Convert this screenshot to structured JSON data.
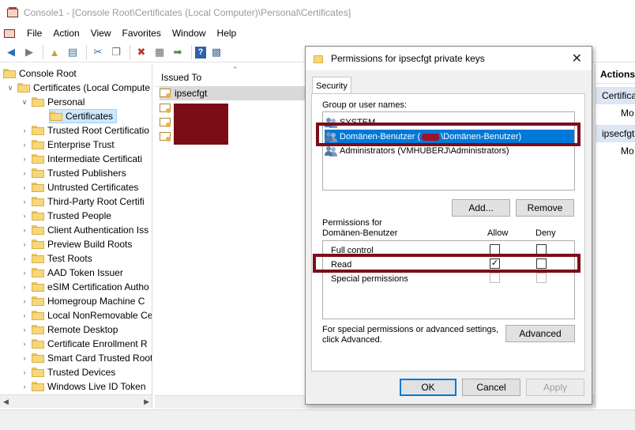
{
  "window": {
    "title": "Console1 - [Console Root\\Certificates (Local Computer)\\Personal\\Certificates]"
  },
  "menu": [
    "File",
    "Action",
    "View",
    "Favorites",
    "Window",
    "Help"
  ],
  "tree": {
    "items": [
      {
        "label": "Console Root"
      },
      {
        "label": "Certificates (Local Compute"
      },
      {
        "label": "Personal"
      },
      {
        "label": "Certificates"
      },
      {
        "label": "Trusted Root Certificatio"
      },
      {
        "label": "Enterprise Trust"
      },
      {
        "label": "Intermediate Certificati"
      },
      {
        "label": "Trusted Publishers"
      },
      {
        "label": "Untrusted Certificates"
      },
      {
        "label": "Third-Party Root Certifi"
      },
      {
        "label": "Trusted People"
      },
      {
        "label": "Client Authentication Iss"
      },
      {
        "label": "Preview Build Roots"
      },
      {
        "label": "Test Roots"
      },
      {
        "label": "AAD Token Issuer"
      },
      {
        "label": "eSIM Certification Autho"
      },
      {
        "label": "Homegroup Machine C"
      },
      {
        "label": "Local NonRemovable Ce"
      },
      {
        "label": "Remote Desktop"
      },
      {
        "label": "Certificate Enrollment R"
      },
      {
        "label": "Smart Card Trusted Root"
      },
      {
        "label": "Trusted Devices"
      },
      {
        "label": "Windows Live ID Token"
      }
    ]
  },
  "list": {
    "column_header": "Issued To",
    "rows": [
      "ipsecfgt"
    ]
  },
  "actions": {
    "header": "Actions",
    "section1": "Certificate",
    "more1": "Mo",
    "section2": "ipsecfgt",
    "more2": "Mo"
  },
  "dialog": {
    "title": "Permissions for ipsecfgt private keys",
    "tab": "Security",
    "group_label": "Group or user names:",
    "users": [
      {
        "name": "SYSTEM"
      },
      {
        "name_prefix": "Domänen-Benutzer (",
        "name_suffix": "\\Domänen-Benutzer)"
      },
      {
        "name": "Administrators (VMHUBERJ\\Administrators)"
      }
    ],
    "add_button": "Add...",
    "remove_button": "Remove",
    "permissions_label_1": "Permissions for",
    "permissions_label_2": "Domänen-Benutzer",
    "allow_header": "Allow",
    "deny_header": "Deny",
    "permissions": [
      {
        "name": "Full control",
        "allow": false,
        "deny": false
      },
      {
        "name": "Read",
        "allow": true,
        "deny": false
      },
      {
        "name": "Special permissions",
        "allow": false,
        "deny": false
      }
    ],
    "special_text_1": "For special permissions or advanced settings,",
    "special_text_2": "click Advanced.",
    "advanced_button": "Advanced",
    "ok_button": "OK",
    "cancel_button": "Cancel",
    "apply_button": "Apply"
  },
  "colors": {
    "highlight_border": "#7b0e19",
    "selection_blue": "#0078d7",
    "redaction": "#7a0d16"
  }
}
